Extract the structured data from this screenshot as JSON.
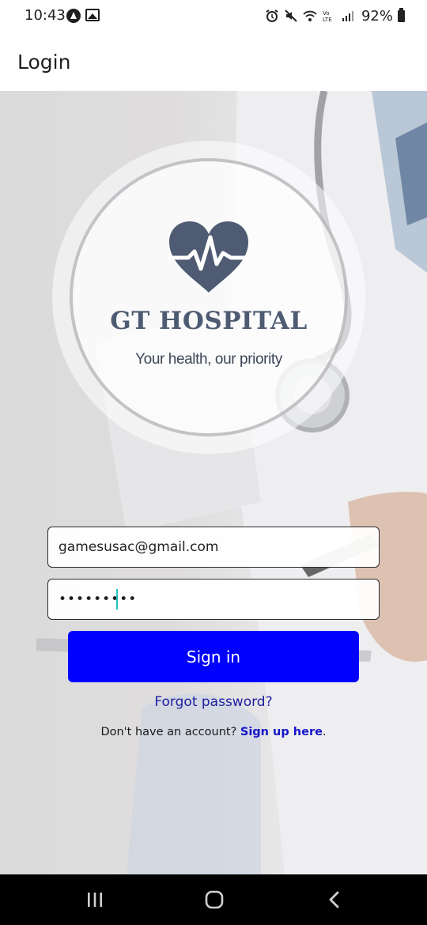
{
  "status_bar": {
    "time": "10:43",
    "battery": "92%",
    "icons": [
      "android-app-icon",
      "gallery-icon",
      "alarm-icon",
      "mute-icon",
      "wifi-icon",
      "volte-icon",
      "signal-icon",
      "battery-icon"
    ]
  },
  "app_bar": {
    "title": "Login"
  },
  "logo": {
    "name": "GT HOSPITAL",
    "tagline": "Your health, our priority",
    "color": "#4e5b72"
  },
  "form": {
    "email_value": "gamesusac@gmail.com",
    "password_masked": "•••••••••",
    "signin_label": "Sign in",
    "signin_color": "#0000ff",
    "forgot_label": "Forgot password?",
    "signup_prompt": "Don't have an account? ",
    "signup_link": "Sign up here",
    "signup_suffix": "."
  },
  "nav_bar": {
    "buttons": [
      "recents-icon",
      "home-icon",
      "back-icon"
    ]
  }
}
